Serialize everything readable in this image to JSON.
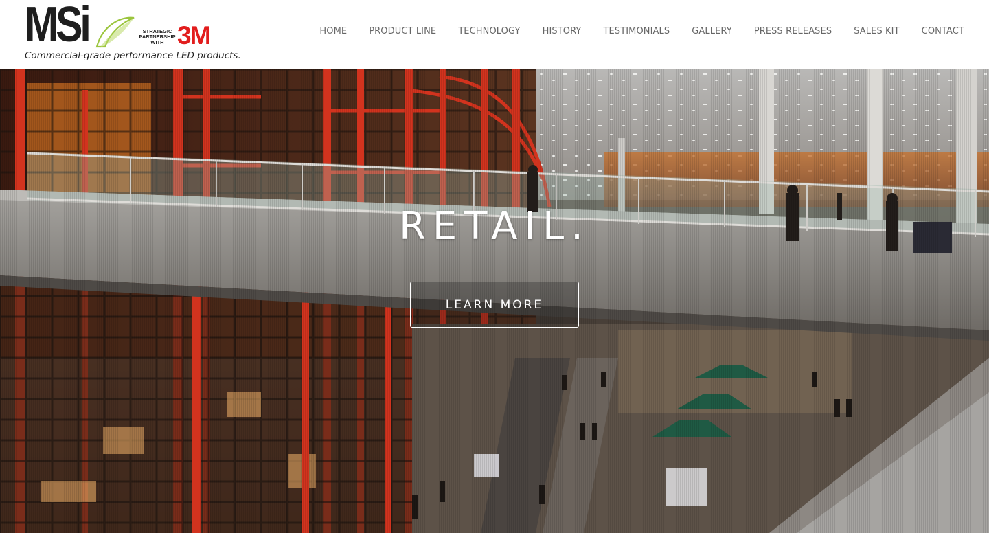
{
  "logo": {
    "brand": "MSi",
    "partnership_lines": [
      "STRATEGIC",
      "PARTNERSHIP",
      "WITH"
    ],
    "partner_brand": "3M",
    "tagline": "Commercial-grade performance LED products.",
    "brand_color": "#1e1e1e",
    "leaf_color": "#9bc53d",
    "partner_color": "#e21d1d"
  },
  "nav": {
    "items": [
      {
        "label": "HOME"
      },
      {
        "label": "PRODUCT LINE"
      },
      {
        "label": "TECHNOLOGY"
      },
      {
        "label": "HISTORY"
      },
      {
        "label": "TESTIMONIALS"
      },
      {
        "label": "GALLERY"
      },
      {
        "label": "PRESS RELEASES"
      },
      {
        "label": "SALES KIT"
      },
      {
        "label": "CONTACT"
      }
    ],
    "text_color": "#666666"
  },
  "hero": {
    "title": "RETAIL.",
    "button_label": "LEARN MORE",
    "image_subject": "airport-terminal-interior-photo"
  }
}
